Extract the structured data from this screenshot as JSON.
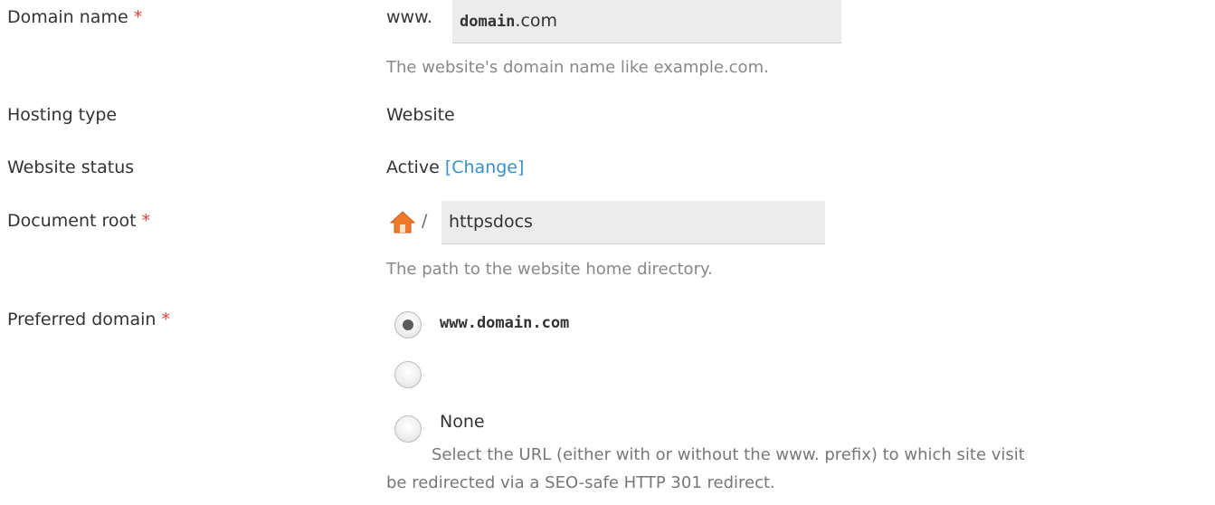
{
  "domain_name": {
    "label": "Domain name",
    "required_mark": "*",
    "prefix": "www.",
    "value": "domain",
    "suffix": ".com",
    "hint": "The website's domain name like example.com."
  },
  "hosting_type": {
    "label": "Hosting type",
    "value": "Website"
  },
  "website_status": {
    "label": "Website status",
    "value": "Active",
    "change_link": "[Change]"
  },
  "document_root": {
    "label": "Document root",
    "required_mark": "*",
    "icon": "home-icon",
    "separator": "/",
    "value": "httpsdocs",
    "hint": "The path to the website home directory."
  },
  "preferred_domain": {
    "label": "Preferred domain",
    "required_mark": "*",
    "options": [
      {
        "label": "www.domain.com",
        "selected": true
      },
      {
        "label": "",
        "selected": false
      },
      {
        "label": "None",
        "selected": false
      }
    ],
    "hint_line1": "Select the URL (either with or without the www. prefix) to which site visit",
    "hint_line2": "be redirected via a SEO-safe HTTP 301 redirect."
  },
  "colors": {
    "required": "#e0403a",
    "link": "#3b8fc7",
    "hint": "#888888",
    "input_bg": "#ececec",
    "home_icon": "#f07a2a"
  }
}
